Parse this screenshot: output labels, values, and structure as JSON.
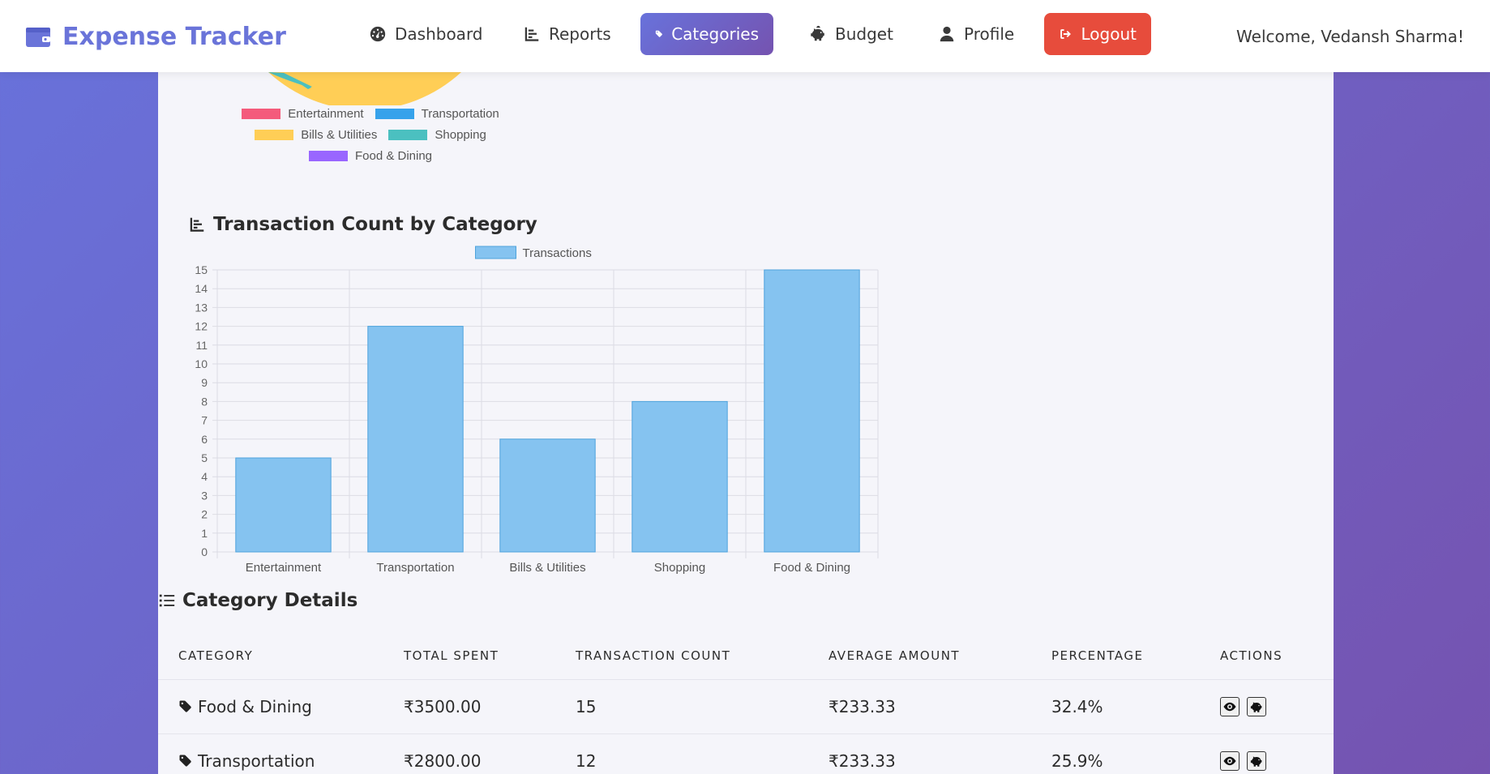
{
  "navbar": {
    "brand": "Expense Tracker",
    "items": [
      {
        "label": "Dashboard",
        "icon": "dashboard-icon"
      },
      {
        "label": "Reports",
        "icon": "chart-bar-icon"
      },
      {
        "label": "Categories",
        "icon": "tags-icon",
        "active": true
      },
      {
        "label": "Budget",
        "icon": "piggy-bank-icon"
      },
      {
        "label": "Profile",
        "icon": "user-icon"
      }
    ],
    "logout": "Logout",
    "welcome": "Welcome, Vedansh Sharma!"
  },
  "colors": {
    "accent": "#6a74d9",
    "logout": "#e74c3c",
    "entertainment": "#f45b7c",
    "transportation": "#36a2eb",
    "bills": "#ffce56",
    "shopping": "#4bc0c0",
    "food": "#9966ff",
    "bar_fill": "#85c3f0",
    "bar_border": "#4ea3dc"
  },
  "pie_legend": [
    {
      "label": "Entertainment",
      "color": "#f45b7c"
    },
    {
      "label": "Transportation",
      "color": "#36a2eb"
    },
    {
      "label": "Bills & Utilities",
      "color": "#ffce56"
    },
    {
      "label": "Shopping",
      "color": "#4bc0c0"
    },
    {
      "label": "Food & Dining",
      "color": "#9966ff"
    }
  ],
  "chart_section": {
    "title": "Transaction Count by Category"
  },
  "chart_data": {
    "type": "bar",
    "title": "Transaction Count by Category",
    "categories": [
      "Entertainment",
      "Transportation",
      "Bills & Utilities",
      "Shopping",
      "Food & Dining"
    ],
    "series": [
      {
        "name": "Transactions",
        "values": [
          5,
          12,
          6,
          8,
          15
        ]
      }
    ],
    "ylim": [
      0,
      15
    ],
    "yticks": [
      0,
      1,
      2,
      3,
      4,
      5,
      6,
      7,
      8,
      9,
      10,
      11,
      12,
      13,
      14,
      15
    ],
    "grid": true,
    "legend_position": "top"
  },
  "details": {
    "title": "Category Details",
    "headers": [
      "CATEGORY",
      "TOTAL SPENT",
      "TRANSACTION COUNT",
      "AVERAGE AMOUNT",
      "PERCENTAGE",
      "ACTIONS"
    ],
    "rows": [
      {
        "category": "Food & Dining",
        "total": "₹3500.00",
        "count": "15",
        "average": "₹233.33",
        "percentage": "32.4%"
      },
      {
        "category": "Transportation",
        "total": "₹2800.00",
        "count": "12",
        "average": "₹233.33",
        "percentage": "25.9%"
      }
    ]
  }
}
